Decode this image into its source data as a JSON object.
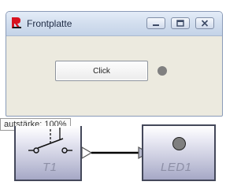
{
  "window": {
    "title": "Frontplatte",
    "button_label": "Click"
  },
  "tooltip": {
    "text": "autstärke: 100%"
  },
  "blocks": {
    "switch_label": "T1",
    "led_label": "LED1"
  },
  "colors": {
    "led": "#808080",
    "block_gradient_end": "#a6a8c6",
    "titlebar": "#d2deee"
  }
}
